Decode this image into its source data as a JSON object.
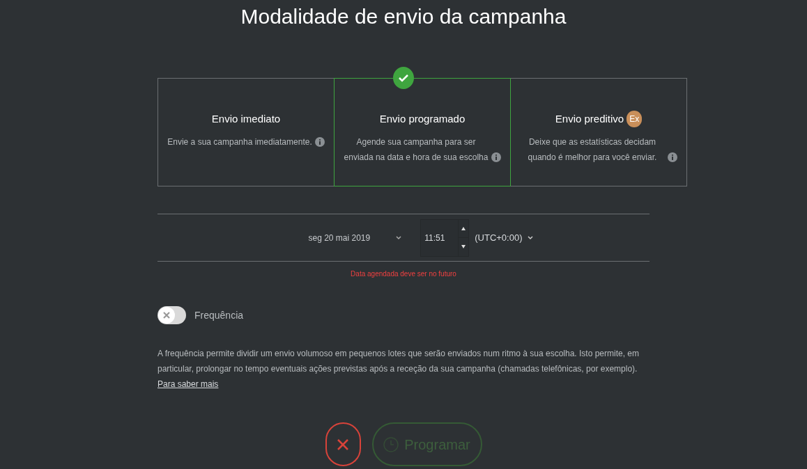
{
  "title": "Modalidade de envio da campanha",
  "options": [
    {
      "title": "Envio imediato",
      "description": "Envie a sua campanha imediatamente.",
      "selected": false
    },
    {
      "title": "Envio programado",
      "description": "Agende sua campanha para ser enviada na data e hora de sua escolha",
      "selected": true
    },
    {
      "title": "Envio preditivo",
      "badge": "Ex",
      "description": "Deixe que as estatísticas decidam quando é melhor para você enviar.",
      "selected": false
    }
  ],
  "schedule": {
    "date": "seg 20 mai 2019",
    "time": "11:51",
    "timezone": "(UTC+0:00)",
    "error": "Data agendada deve ser no futuro"
  },
  "frequency": {
    "label": "Frequência",
    "on": false,
    "description": "A frequência permite dividir um envio volumoso em pequenos lotes que serão enviados num ritmo à sua escolha. Isto permite, em particular, prolongar no tempo eventuais ações previstas após a receção da sua campanha (chamadas telefônicas, por exemplo).",
    "link": "Para saber mais"
  },
  "actions": {
    "submit": {
      "label": "Programar",
      "disabled": true
    }
  }
}
